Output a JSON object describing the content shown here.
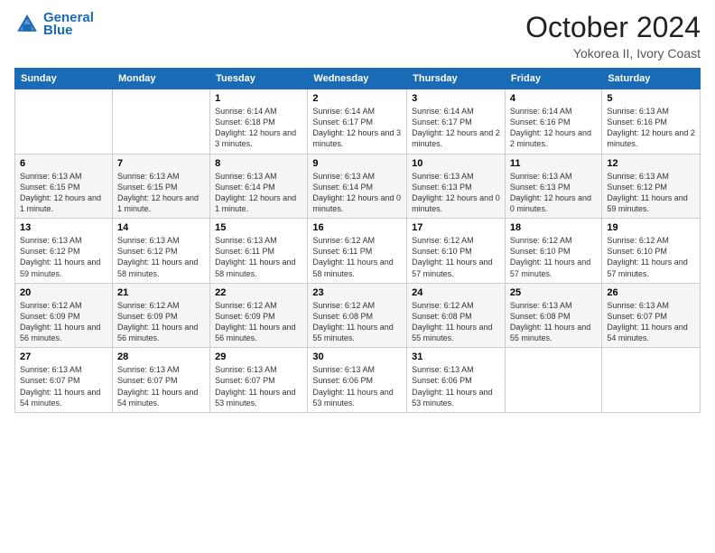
{
  "header": {
    "logo_line1": "General",
    "logo_line2": "Blue",
    "month_title": "October 2024",
    "location": "Yokorea II, Ivory Coast"
  },
  "days_of_week": [
    "Sunday",
    "Monday",
    "Tuesday",
    "Wednesday",
    "Thursday",
    "Friday",
    "Saturday"
  ],
  "weeks": [
    [
      {
        "day": "",
        "info": ""
      },
      {
        "day": "",
        "info": ""
      },
      {
        "day": "1",
        "info": "Sunrise: 6:14 AM\nSunset: 6:18 PM\nDaylight: 12 hours and 3 minutes."
      },
      {
        "day": "2",
        "info": "Sunrise: 6:14 AM\nSunset: 6:17 PM\nDaylight: 12 hours and 3 minutes."
      },
      {
        "day": "3",
        "info": "Sunrise: 6:14 AM\nSunset: 6:17 PM\nDaylight: 12 hours and 2 minutes."
      },
      {
        "day": "4",
        "info": "Sunrise: 6:14 AM\nSunset: 6:16 PM\nDaylight: 12 hours and 2 minutes."
      },
      {
        "day": "5",
        "info": "Sunrise: 6:13 AM\nSunset: 6:16 PM\nDaylight: 12 hours and 2 minutes."
      }
    ],
    [
      {
        "day": "6",
        "info": "Sunrise: 6:13 AM\nSunset: 6:15 PM\nDaylight: 12 hours and 1 minute."
      },
      {
        "day": "7",
        "info": "Sunrise: 6:13 AM\nSunset: 6:15 PM\nDaylight: 12 hours and 1 minute."
      },
      {
        "day": "8",
        "info": "Sunrise: 6:13 AM\nSunset: 6:14 PM\nDaylight: 12 hours and 1 minute."
      },
      {
        "day": "9",
        "info": "Sunrise: 6:13 AM\nSunset: 6:14 PM\nDaylight: 12 hours and 0 minutes."
      },
      {
        "day": "10",
        "info": "Sunrise: 6:13 AM\nSunset: 6:13 PM\nDaylight: 12 hours and 0 minutes."
      },
      {
        "day": "11",
        "info": "Sunrise: 6:13 AM\nSunset: 6:13 PM\nDaylight: 12 hours and 0 minutes."
      },
      {
        "day": "12",
        "info": "Sunrise: 6:13 AM\nSunset: 6:12 PM\nDaylight: 11 hours and 59 minutes."
      }
    ],
    [
      {
        "day": "13",
        "info": "Sunrise: 6:13 AM\nSunset: 6:12 PM\nDaylight: 11 hours and 59 minutes."
      },
      {
        "day": "14",
        "info": "Sunrise: 6:13 AM\nSunset: 6:12 PM\nDaylight: 11 hours and 58 minutes."
      },
      {
        "day": "15",
        "info": "Sunrise: 6:13 AM\nSunset: 6:11 PM\nDaylight: 11 hours and 58 minutes."
      },
      {
        "day": "16",
        "info": "Sunrise: 6:12 AM\nSunset: 6:11 PM\nDaylight: 11 hours and 58 minutes."
      },
      {
        "day": "17",
        "info": "Sunrise: 6:12 AM\nSunset: 6:10 PM\nDaylight: 11 hours and 57 minutes."
      },
      {
        "day": "18",
        "info": "Sunrise: 6:12 AM\nSunset: 6:10 PM\nDaylight: 11 hours and 57 minutes."
      },
      {
        "day": "19",
        "info": "Sunrise: 6:12 AM\nSunset: 6:10 PM\nDaylight: 11 hours and 57 minutes."
      }
    ],
    [
      {
        "day": "20",
        "info": "Sunrise: 6:12 AM\nSunset: 6:09 PM\nDaylight: 11 hours and 56 minutes."
      },
      {
        "day": "21",
        "info": "Sunrise: 6:12 AM\nSunset: 6:09 PM\nDaylight: 11 hours and 56 minutes."
      },
      {
        "day": "22",
        "info": "Sunrise: 6:12 AM\nSunset: 6:09 PM\nDaylight: 11 hours and 56 minutes."
      },
      {
        "day": "23",
        "info": "Sunrise: 6:12 AM\nSunset: 6:08 PM\nDaylight: 11 hours and 55 minutes."
      },
      {
        "day": "24",
        "info": "Sunrise: 6:12 AM\nSunset: 6:08 PM\nDaylight: 11 hours and 55 minutes."
      },
      {
        "day": "25",
        "info": "Sunrise: 6:13 AM\nSunset: 6:08 PM\nDaylight: 11 hours and 55 minutes."
      },
      {
        "day": "26",
        "info": "Sunrise: 6:13 AM\nSunset: 6:07 PM\nDaylight: 11 hours and 54 minutes."
      }
    ],
    [
      {
        "day": "27",
        "info": "Sunrise: 6:13 AM\nSunset: 6:07 PM\nDaylight: 11 hours and 54 minutes."
      },
      {
        "day": "28",
        "info": "Sunrise: 6:13 AM\nSunset: 6:07 PM\nDaylight: 11 hours and 54 minutes."
      },
      {
        "day": "29",
        "info": "Sunrise: 6:13 AM\nSunset: 6:07 PM\nDaylight: 11 hours and 53 minutes."
      },
      {
        "day": "30",
        "info": "Sunrise: 6:13 AM\nSunset: 6:06 PM\nDaylight: 11 hours and 53 minutes."
      },
      {
        "day": "31",
        "info": "Sunrise: 6:13 AM\nSunset: 6:06 PM\nDaylight: 11 hours and 53 minutes."
      },
      {
        "day": "",
        "info": ""
      },
      {
        "day": "",
        "info": ""
      }
    ]
  ]
}
